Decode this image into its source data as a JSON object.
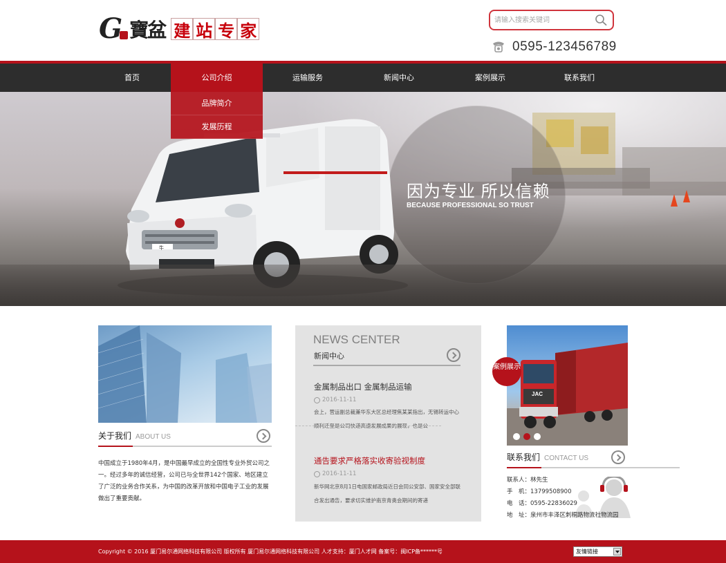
{
  "header": {
    "logo_g": "G",
    "logo_script": "寶盆",
    "logo_boxes": [
      "建",
      "站",
      "专",
      "家"
    ],
    "search_placeholder": "请输入搜索关键词",
    "phone": "0595-123456789"
  },
  "nav": {
    "items": [
      "首页",
      "公司介绍",
      "运输服务",
      "新闻中心",
      "案例展示",
      "联系我们"
    ],
    "active": "公司介绍",
    "dropdown": [
      "品牌简介",
      "发展历程"
    ]
  },
  "banner": {
    "slogan": "因为专业 所以信赖",
    "slogan_en": "BECAUSE PROFESSIONAL SO TRUST",
    "van_plate": "牛"
  },
  "about": {
    "title": "关于我们",
    "title_en": "ABOUT US",
    "text": "中国成立于1980年4月，是中国最早成立的全国性专业外贸公司之一。经过多年的诚信经营，公司已与全世界142个国家、地区建立了广泛的业务合作关系，为中国的改革开放和中国电子工业的发展做出了重要贡献。"
  },
  "news": {
    "title_en": "NEWS CENTER",
    "title": "新闻中心",
    "items": [
      {
        "title": "金属制品出口 金属制品运输",
        "date": "2016-11-11",
        "desc": "会上，营运副总裁兼华东大区总经理焦某某指出，无锡转运中心顺利迁至是公司快递高速发展成果的展现，也是公"
      },
      {
        "title": "通告要求严格落实收寄验视制度",
        "date": "2016-11-11",
        "desc": "新华网北京8月1日电国家邮政局近日会同公安部、国家安全部联合发出通告，要求切实维护南京青奥会期间的寄递"
      }
    ]
  },
  "cases": {
    "badge": "案例展示",
    "truck_brand": "JAC"
  },
  "contact": {
    "title": "联系我们",
    "title_en": "CONTACT US",
    "lines": [
      "联系人：林先生",
      "手　机：13799508900",
      "电　话：0595-22836029",
      "地　址：泉州市丰泽区刺桐路物流社物流园"
    ]
  },
  "footer": {
    "copyright": "Copyright © 2016 厦门易尔通网络科技有限公司 版权所有 厦门易尔通网络科技有限公司 人才支持：厦门人才网 备案号：闽ICP备******号",
    "links_select": "友情链接"
  },
  "colors": {
    "brand_red": "#b5121b",
    "nav_dark": "#2d2d2d",
    "news_bg": "#e3e3e3"
  }
}
